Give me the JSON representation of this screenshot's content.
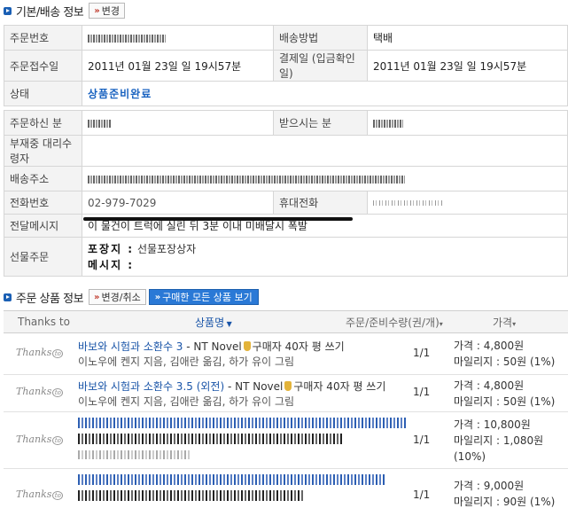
{
  "section1": {
    "title": "기본/배송 정보",
    "change_btn": "변경"
  },
  "order": {
    "order_no_label": "주문번호",
    "delivery_method_label": "배송방법",
    "delivery_method_value": "택배",
    "order_date_label": "주문접수일",
    "order_date_value": "2011년 01월 23일 일 19시57분",
    "payment_date_label": "결제일 (입금확인일)",
    "payment_date_value": "2011년 01월 23일 일 19시57분",
    "status_label": "상태",
    "status_value": "상품준비완료"
  },
  "shipping": {
    "orderer_label": "주문하신 분",
    "receiver_label": "받으시는 분",
    "proxy_label": "부재중 대리수령자",
    "address_label": "배송주소",
    "phone_label": "전화번호",
    "phone_value": "02-979-7029",
    "mobile_label": "휴대전화",
    "message_label": "전달메시지",
    "message_value": "이 물건이 트럭에 실린 뒤 3분 이내 미배달시 폭발",
    "gift_label": "선물주문",
    "wrap_label": "포장지 :",
    "wrap_value": "선물포장상자",
    "gift_msg_label": "메시지 :"
  },
  "section2": {
    "title": "주문 상품 정보",
    "change_cancel_btn": "변경/취소",
    "view_all_btn": "구매한 모든 상품 보기"
  },
  "grid": {
    "col_thanks": "Thanks to",
    "col_name": "상품명",
    "col_qty": "주문/준비수량(권/개)",
    "col_price": "가격"
  },
  "items": [
    {
      "thanks": "Thanks",
      "title": "바보와 시험과 소환수 3",
      "suffix": " - NT Novel",
      "review": "구매자 40자 평 쓰기",
      "author": "이노우에 켄지 지음, 김애란 옮김, 하가 유이 그림",
      "qty": "1/1",
      "price": "가격 : 4,800원",
      "mileage": "마일리지 : 50원 (1%)"
    },
    {
      "thanks": "Thanks",
      "title": "바보와 시험과 소환수 3.5 (외전)",
      "suffix": " - NT Novel",
      "review": "구매자 40자 평 쓰기",
      "author": "이노우에 켄지 지음, 김애란 옮김, 하가 유이 그림",
      "qty": "1/1",
      "price": "가격 : 4,800원",
      "mileage": "마일리지 : 50원 (1%)"
    },
    {
      "thanks": "Thanks",
      "qty": "1/1",
      "price": "가격 : 10,800원",
      "mileage": "마일리지 : 1,080원",
      "mileage_rate": "(10%)"
    },
    {
      "thanks": "Thanks",
      "qty": "1/1",
      "price": "가격 : 9,000원",
      "mileage": "마일리지 : 90원 (1%)"
    }
  ]
}
